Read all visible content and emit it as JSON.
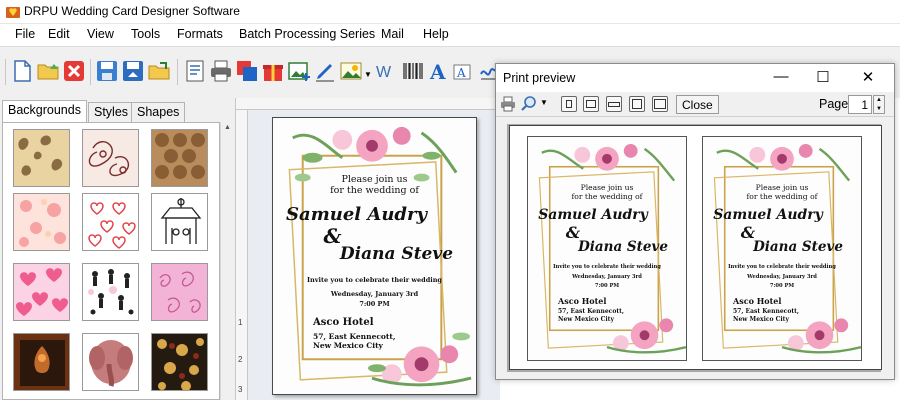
{
  "window": {
    "title": "DRPU Wedding Card Designer Software"
  },
  "menu": [
    "File",
    "Edit",
    "View",
    "Tools",
    "Formats",
    "Batch Processing Series",
    "Mail",
    "Help"
  ],
  "left_panel": {
    "tabs": [
      "Backgrounds",
      "Styles",
      "Shapes"
    ],
    "active_tab": "Backgrounds"
  },
  "ruler": {
    "left_marks": [
      "1",
      "2",
      "3"
    ]
  },
  "card": {
    "line1": "Please join us",
    "line2": "for the wedding of",
    "name1": "Samuel Audry",
    "amp": "&",
    "name2": "Diana Steve",
    "invite": "Invite you to celebrate their wedding",
    "date": "Wednesday, January 3rd",
    "time": "7:00 PM",
    "venue": "Asco Hotel",
    "address1": "57, East Kennecott,",
    "address2": "New Mexico City"
  },
  "print_preview": {
    "title": "Print preview",
    "close_label": "Close",
    "page_label": "Page",
    "page_value": "1",
    "minimize": "—",
    "maximize": "☐",
    "close_x": "✕"
  },
  "colors": {
    "frame_gold": "#c9a24a",
    "accent_blue": "#1f6fc5"
  }
}
